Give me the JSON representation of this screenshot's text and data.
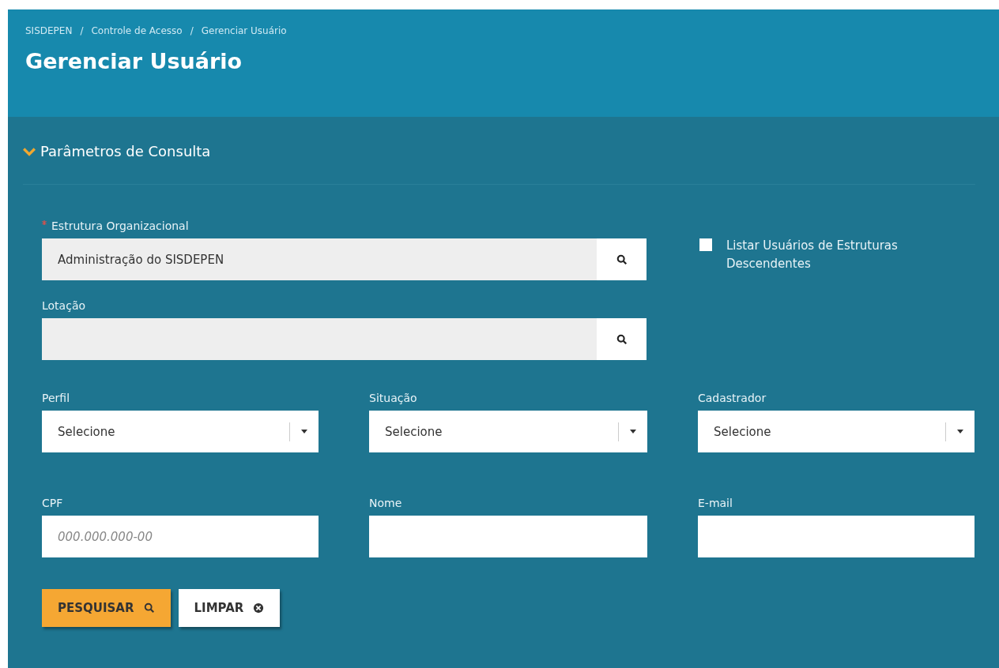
{
  "breadcrumb": [
    "SISDEPEN",
    "Controle de Acesso",
    "Gerenciar Usuário"
  ],
  "breadcrumb_separator": "/",
  "title": "Gerenciar Usuário",
  "section": {
    "title": "Parâmetros de Consulta",
    "expanded": true
  },
  "lookups": [
    {
      "label": "Estrutura Organizacional",
      "required": true,
      "value": "Administração do SISDEPEN"
    },
    {
      "label": "Lotação",
      "required": false
    }
  ],
  "checkbox": {
    "label": "Listar Usuários de Estruturas Descendentes",
    "checked": false
  },
  "selects": [
    {
      "label": "Perfil",
      "value": "Selecione"
    },
    {
      "label": "Situação",
      "value": "Selecione"
    },
    {
      "label": "Cadastrador",
      "value": "Selecione"
    }
  ],
  "inputs": [
    {
      "label": "CPF",
      "placeholder": "000.000.000-00"
    },
    {
      "label": "Nome"
    },
    {
      "label": "E-mail"
    }
  ],
  "buttons": [
    {
      "label": "PESQUISAR",
      "kind": "primary"
    },
    {
      "label": "LIMPAR",
      "kind": "secondary"
    }
  ]
}
